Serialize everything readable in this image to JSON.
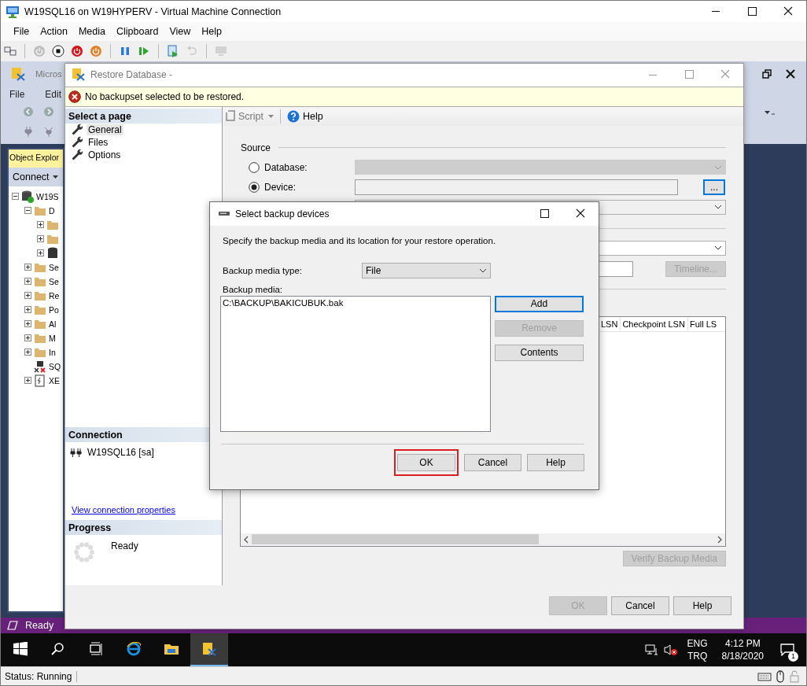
{
  "vm_window": {
    "title": "W19SQL16 on W19HYPERV - Virtual Machine Connection",
    "menu": [
      "File",
      "Action",
      "Media",
      "Clipboard",
      "View",
      "Help"
    ],
    "toolbar_groups": [
      [
        {
          "kind": "ctrl_alt_del",
          "disabled": false
        }
      ],
      [
        {
          "kind": "start",
          "disabled": true
        },
        {
          "kind": "turn_off",
          "disabled": false
        },
        {
          "kind": "shutdown",
          "disabled": false
        },
        {
          "kind": "save",
          "disabled": false
        }
      ],
      [
        {
          "kind": "pause",
          "disabled": false
        },
        {
          "kind": "resume",
          "disabled": false
        }
      ],
      [
        {
          "kind": "checkpoint",
          "disabled": false
        },
        {
          "kind": "revert",
          "disabled": true
        }
      ],
      [
        {
          "kind": "enhanced",
          "disabled": true
        }
      ]
    ],
    "status": "Status: Running"
  },
  "ssms": {
    "title": "Micros",
    "menu": [
      "File",
      "Edit"
    ],
    "object_explorer": {
      "title": "Object Explor",
      "connect": "Connect",
      "tree": [
        {
          "label": "W19S",
          "kind": "server",
          "expanded": true,
          "children": [
            {
              "label": "D",
              "kind": "folder",
              "expanded": true,
              "children": [
                {
                  "kind": "folder",
                  "expanded": false
                },
                {
                  "kind": "folder",
                  "expanded": false
                },
                {
                  "kind": "database",
                  "expanded": false
                }
              ]
            },
            {
              "label": "Se",
              "kind": "folder",
              "expanded": false
            },
            {
              "label": "Se",
              "kind": "folder",
              "expanded": false
            },
            {
              "label": "Re",
              "kind": "folder",
              "expanded": false
            },
            {
              "label": "Po",
              "kind": "folder",
              "expanded": false
            },
            {
              "label": "Al",
              "kind": "folder",
              "expanded": false
            },
            {
              "label": "M",
              "kind": "folder",
              "expanded": false
            },
            {
              "label": "In",
              "kind": "folder",
              "expanded": false
            },
            {
              "label": "SQ",
              "kind": "agent"
            },
            {
              "label": "XE",
              "kind": "xevent",
              "expanded": false
            }
          ]
        }
      ]
    },
    "status": "Ready"
  },
  "restore_dialog": {
    "title": "Restore Database -",
    "message": "No backupset selected to be restored.",
    "pages_title": "Select a page",
    "pages": [
      {
        "label": "General",
        "selected": true
      },
      {
        "label": "Files",
        "selected": false
      },
      {
        "label": "Options",
        "selected": false
      }
    ],
    "connection_title": "Connection",
    "connection": "W19SQL16 [sa]",
    "connection_link": "View connection properties",
    "progress_title": "Progress",
    "progress_status": "Ready",
    "toolbar": {
      "script": "Script",
      "help": "Help"
    },
    "source": {
      "title": "Source",
      "options": [
        {
          "label": "Database:",
          "selected": false,
          "disabled": true
        },
        {
          "label": "Device:",
          "selected": true,
          "disabled": false
        }
      ],
      "browse": "..."
    },
    "timeline_button": {
      "label": "Timeline...",
      "disabled": true
    },
    "backup_sets_columns": [
      "LSN",
      "Checkpoint LSN",
      "Full LS"
    ],
    "verify_button": {
      "label": "Verify Backup Media",
      "disabled": true
    },
    "buttons": [
      {
        "label": "OK",
        "disabled": true
      },
      {
        "label": "Cancel",
        "disabled": false
      },
      {
        "label": "Help",
        "disabled": false
      }
    ]
  },
  "backup_devices_dialog": {
    "title": "Select backup devices",
    "description": "Specify the backup media and its location for your restore operation.",
    "media_type_label": "Backup media type:",
    "media_type": "File",
    "media_label": "Backup media:",
    "media": [
      "C:\\BACKUP\\BAKICUBUK.bak"
    ],
    "side_buttons": [
      {
        "label": "Add",
        "disabled": false,
        "focused": true
      },
      {
        "label": "Remove",
        "disabled": true,
        "focused": false
      },
      {
        "label": "Contents",
        "disabled": false,
        "focused": false
      }
    ],
    "buttons": [
      {
        "label": "OK",
        "highlighted": true
      },
      {
        "label": "Cancel",
        "highlighted": false
      },
      {
        "label": "Help",
        "highlighted": false
      }
    ]
  },
  "taskbar": {
    "items": [
      {
        "kind": "start",
        "selected": false
      },
      {
        "kind": "search",
        "selected": false
      },
      {
        "kind": "task_view",
        "selected": false
      },
      {
        "kind": "browser",
        "selected": false
      },
      {
        "kind": "folder",
        "selected": false
      },
      {
        "kind": "ssms",
        "selected": true
      }
    ],
    "language": "ENG",
    "keyboard": "TRQ",
    "time": "4:12 PM",
    "date": "8/18/2020",
    "notifications": "1"
  }
}
